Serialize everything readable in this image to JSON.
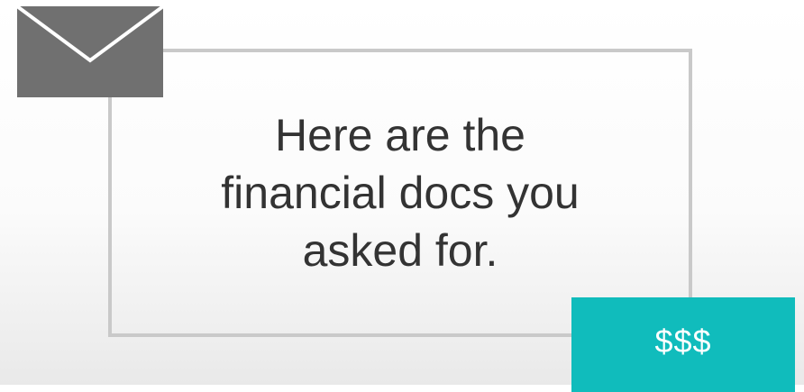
{
  "message": {
    "text": "Here are the\nfinancial docs you\nasked for."
  },
  "attachment": {
    "label": "$$$"
  },
  "envelope_icon": "envelope-icon",
  "colors": {
    "envelope": "#707070",
    "message_border": "#c9c9c9",
    "message_text": "#333333",
    "attachment_background": "#10bcbc",
    "attachment_text": "#ffffff"
  }
}
